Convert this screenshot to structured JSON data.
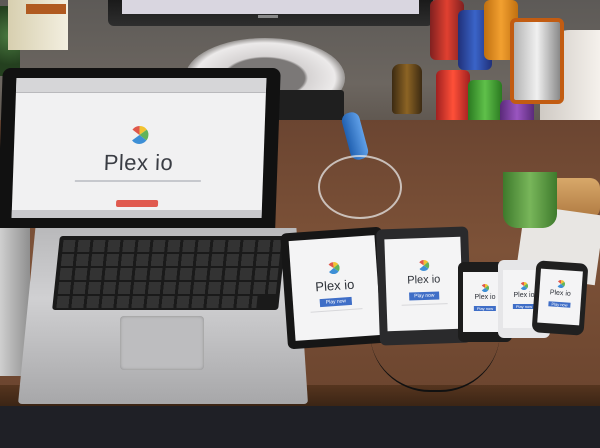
{
  "scene": {
    "laptop": {
      "screen_title": "Plex io"
    },
    "devices": [
      {
        "id": "tablet-large",
        "wordmark": "Plex io",
        "button": "Play now"
      },
      {
        "id": "tablet-nexus",
        "wordmark": "Plex io",
        "button": "Play now"
      },
      {
        "id": "phone-black",
        "wordmark": "Plex io",
        "button": "Play now"
      },
      {
        "id": "phone-white",
        "wordmark": "Plex io",
        "button": "Play now"
      },
      {
        "id": "phone-small",
        "wordmark": "Plex io",
        "button": "Play now"
      }
    ],
    "colors": {
      "logo_red": "#e0574a",
      "logo_yellow": "#f2c230",
      "logo_blue": "#3d8fd6",
      "logo_green": "#62b35a",
      "button_blue": "#3f6ec7",
      "cta_red": "#e05a4f",
      "desk_wood": "#7d5238",
      "mug_green": "#5fa046"
    }
  }
}
